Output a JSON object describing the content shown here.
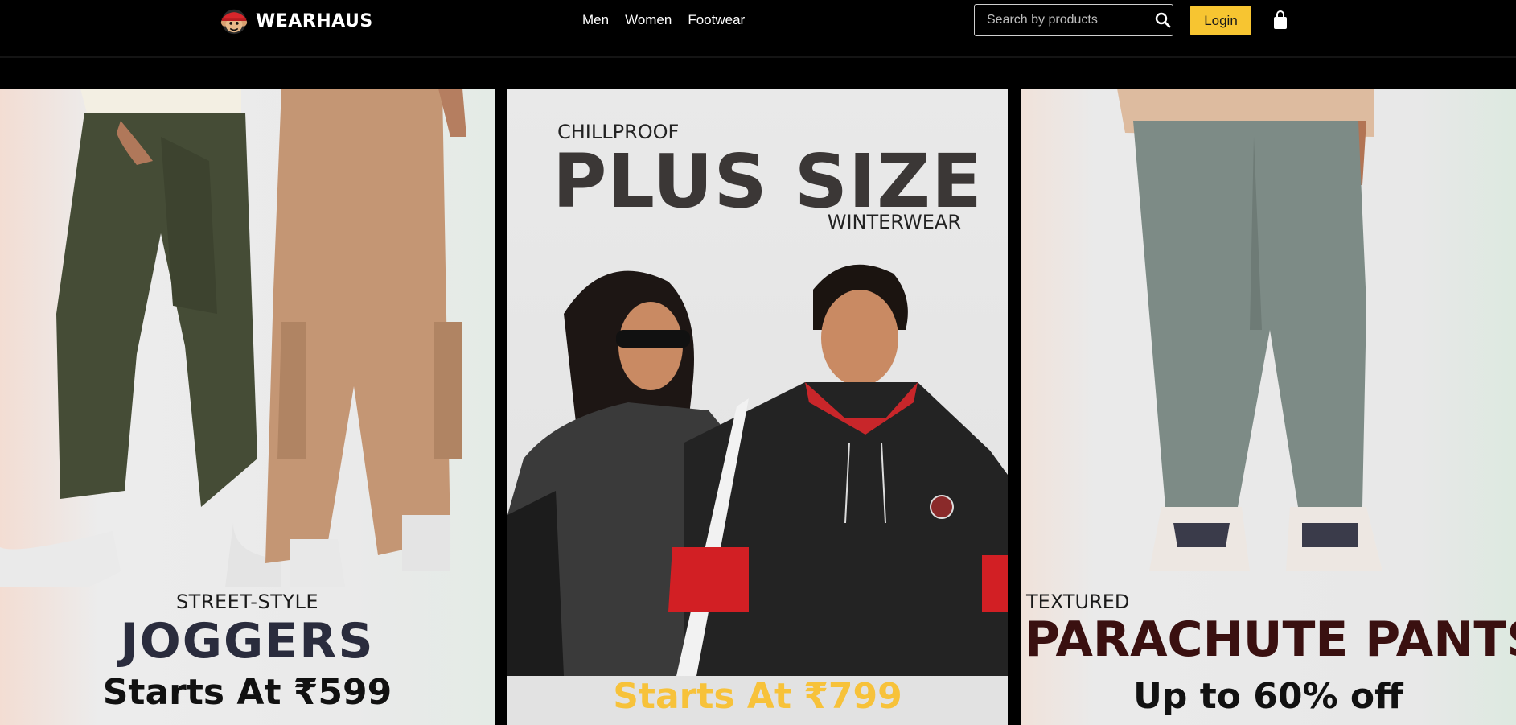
{
  "header": {
    "brand": "WEARHAUS",
    "nav": [
      "Men",
      "Women",
      "Footwear"
    ],
    "search_placeholder": "Search by products",
    "login_label": "Login"
  },
  "colors": {
    "header_bg": "#000000",
    "login_bg": "#f7c531",
    "accent_yellow": "#f7c23a"
  },
  "icons": {
    "search": "search-icon",
    "cart": "shopping-bag-icon",
    "logo": "monkey-mascot-icon"
  },
  "cards": [
    {
      "eyebrow": "STREET-STYLE",
      "headline": "JOGGERS",
      "price": "Starts At ₹599"
    },
    {
      "eyebrow": "CHILLPROOF",
      "headline": "PLUS SIZE",
      "sub": "WINTERWEAR",
      "price": "Starts At ₹799"
    },
    {
      "eyebrow": "TEXTURED",
      "headline": "PARACHUTE PANTS",
      "offer": "Up to 60% off"
    }
  ]
}
